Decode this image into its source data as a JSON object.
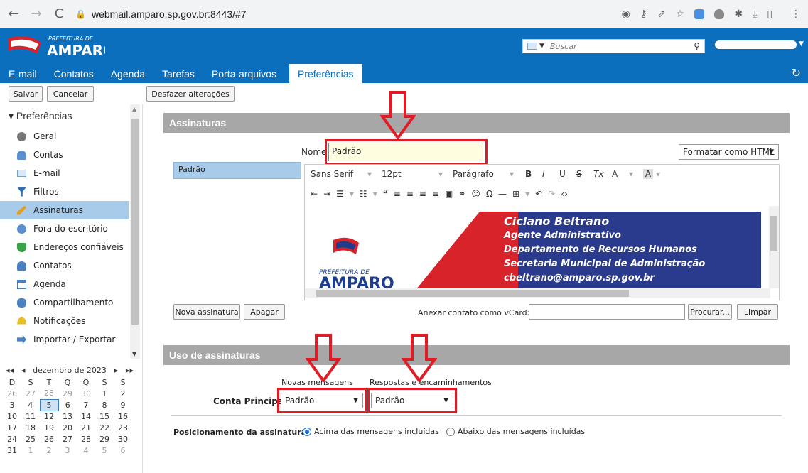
{
  "browser": {
    "url": "webmail.amparo.sp.gov.br:8443/#7"
  },
  "header": {
    "logo_top": "PREFEITURA DE",
    "logo_main": "AMPARO",
    "search_placeholder": "Buscar"
  },
  "tabs": [
    "E-mail",
    "Contatos",
    "Agenda",
    "Tarefas",
    "Porta-arquivos",
    "Preferências"
  ],
  "toolbar": {
    "save": "Salvar",
    "cancel": "Cancelar",
    "undo": "Desfazer alterações"
  },
  "sidebar": {
    "title": "Preferências",
    "items": [
      {
        "label": "Geral",
        "icon": "gear-icon"
      },
      {
        "label": "Contas",
        "icon": "accounts-icon"
      },
      {
        "label": "E-mail",
        "icon": "envelope-icon"
      },
      {
        "label": "Filtros",
        "icon": "filter-icon"
      },
      {
        "label": "Assinaturas",
        "icon": "pen-icon"
      },
      {
        "label": "Fora do escritório",
        "icon": "out-of-office-icon"
      },
      {
        "label": "Endereços confiáveis",
        "icon": "shield-check-icon"
      },
      {
        "label": "Contatos",
        "icon": "contact-icon"
      },
      {
        "label": "Agenda",
        "icon": "calendar-icon"
      },
      {
        "label": "Compartilhamento",
        "icon": "share-icon"
      },
      {
        "label": "Notificações",
        "icon": "bell-icon"
      },
      {
        "label": "Importar / Exportar",
        "icon": "import-export-icon"
      }
    ]
  },
  "calendar": {
    "prev_year": "◂◂",
    "prev": "◂",
    "month": "dezembro de 2023",
    "next": "▸",
    "next_year": "▸▸",
    "weekdays": [
      "D",
      "S",
      "T",
      "Q",
      "Q",
      "S",
      "S"
    ],
    "rows": [
      [
        "26",
        "27",
        "28",
        "29",
        "30",
        "1",
        "2"
      ],
      [
        "3",
        "4",
        "5",
        "6",
        "7",
        "8",
        "9"
      ],
      [
        "10",
        "11",
        "12",
        "13",
        "14",
        "15",
        "16"
      ],
      [
        "17",
        "18",
        "19",
        "20",
        "21",
        "22",
        "23"
      ],
      [
        "24",
        "25",
        "26",
        "27",
        "28",
        "29",
        "30"
      ],
      [
        "31",
        "1",
        "2",
        "3",
        "4",
        "5",
        "6"
      ]
    ]
  },
  "signatures": {
    "section_title": "Assinaturas",
    "name_label": "Nome",
    "name_value": "Padrão",
    "format_button": "Formatar como HTML",
    "list_item": "Padrão",
    "toolbar": {
      "font": "Sans Serif",
      "size": "12pt",
      "paragraph": "Parágrafo"
    },
    "preview": {
      "line1": "Ciclano Beltrano",
      "line2": "Agente Administrativo",
      "line3": "Departamento de Recursos Humanos",
      "line4": "Secretaria Municipal de Administração",
      "line5": "cbeltrano@amparo.sp.gov.br",
      "logo_top": "PREFEITURA DE",
      "logo_main": "AMPARO"
    },
    "new_button": "Nova assinatura",
    "delete_button": "Apagar",
    "vcard_label": "Anexar contato como vCard:",
    "browse_button": "Procurar...",
    "clear_button": "Limpar"
  },
  "usage": {
    "section_title": "Uso de assinaturas",
    "new_messages": "Novas mensagens",
    "replies": "Respostas e encaminhamentos",
    "account_label": "Conta Principal:",
    "new_select": "Padrão",
    "reply_select": "Padrão",
    "position_label": "Posicionamento da assinatura:",
    "above": "Acima das mensagens incluídas",
    "below": "Abaixo das mensagens incluídas"
  },
  "colors": {
    "brand_blue": "#0b6fbd",
    "highlight_red": "#e01b24",
    "selection": "#a9cbea"
  }
}
